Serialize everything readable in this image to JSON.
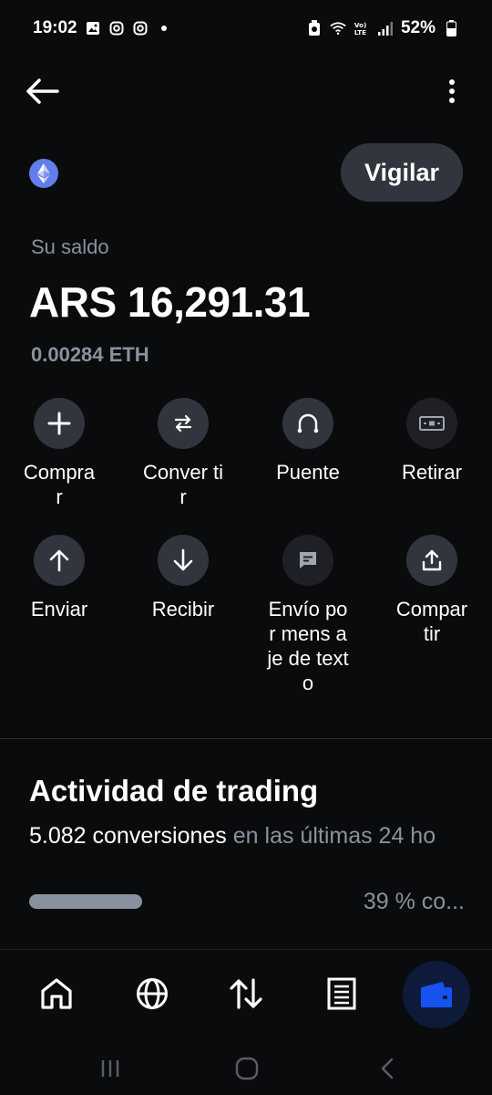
{
  "status_bar": {
    "time": "19:02",
    "battery": "52%",
    "icons": [
      "image-icon",
      "instagram-icon",
      "instagram-icon",
      "notification-dot",
      "nfc-icon",
      "wifi-icon",
      "volte-icon",
      "signal-icon",
      "battery-icon"
    ]
  },
  "header": {
    "back_icon": "arrow-left-icon",
    "more_icon": "more-vertical-icon"
  },
  "asset": {
    "icon": "ethereum-icon",
    "watch_label": "Vigilar"
  },
  "balance": {
    "label": "Su saldo",
    "value": "ARS 16,291.31",
    "crypto": "0.00284 ETH"
  },
  "actions": [
    {
      "label": "Compra r",
      "icon": "plus-icon"
    },
    {
      "label": "Conver tir",
      "icon": "convert-icon"
    },
    {
      "label": "Puente",
      "icon": "bridge-icon"
    },
    {
      "label": "Retirar",
      "icon": "cash-icon"
    },
    {
      "label": "Enviar",
      "icon": "arrow-up-icon"
    },
    {
      "label": "Recibir",
      "icon": "arrow-down-icon"
    },
    {
      "label": "Envío por mens aje de texto",
      "icon": "message-icon"
    },
    {
      "label": "Compar tir",
      "icon": "share-icon"
    }
  ],
  "trading": {
    "title": "Actividad de trading",
    "count": "5.082 conversiones",
    "period": " en las últimas 24 ho",
    "progress_label": "39 % co..."
  },
  "bottom_nav": [
    {
      "name": "home",
      "icon": "home-icon"
    },
    {
      "name": "explore",
      "icon": "globe-icon"
    },
    {
      "name": "trade",
      "icon": "swap-vertical-icon"
    },
    {
      "name": "activity",
      "icon": "document-icon"
    },
    {
      "name": "wallet",
      "icon": "wallet-icon",
      "active": true
    }
  ],
  "colors": {
    "background": "#0a0b0d",
    "muted_text": "#8a919e",
    "button_bg": "#32353d",
    "accent_blue": "#1652f0",
    "eth_blue": "#627eea"
  }
}
